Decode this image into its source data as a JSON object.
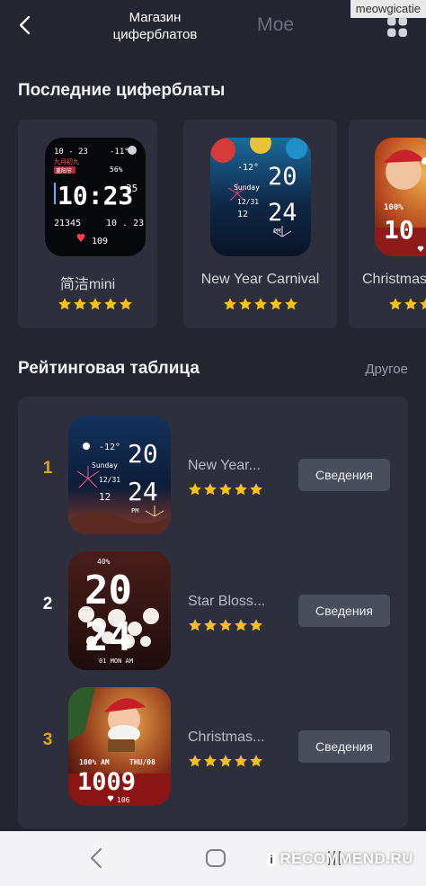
{
  "watermark_top": "meowgicatie",
  "header": {
    "tab_store": "Магазин циферблатов",
    "tab_mine": "Мое"
  },
  "recent": {
    "title": "Последние циферблаты",
    "items": [
      {
        "name": "简洁mini",
        "face": {
          "date": "10 - 23",
          "temp": "-11°",
          "subtitle": "九月初九",
          "tag": "重阳节",
          "battery": "56%",
          "time": "10:23",
          "seconds": "35",
          "steps": "21345",
          "date2": "10 . 23",
          "heart": "109"
        }
      },
      {
        "name": "New Year Carnival",
        "face": {
          "temp": "-12°",
          "day": "Sunday",
          "date": "12/31",
          "date2": "12",
          "hours": "20",
          "minutes": "24",
          "ampm": "PM"
        }
      },
      {
        "name": "Christmas",
        "face": {
          "battery": "100%",
          "time": "10"
        }
      }
    ]
  },
  "leaderboard": {
    "title": "Рейтинговая таблица",
    "other": "Другое",
    "button_label": "Сведения",
    "rows": [
      {
        "rank": "1",
        "rank_color": "#e2a317",
        "name": "New Year...",
        "face": {
          "temp": "-12°",
          "day": "Sunday",
          "date": "12/31",
          "date2": "12",
          "hours": "20",
          "minutes": "24",
          "ampm": "PM"
        }
      },
      {
        "rank": "2",
        "rank_color": "#ffffff",
        "name": "Star Bloss...",
        "face": {
          "battery": "40%",
          "hours": "20",
          "minutes": "24",
          "weekday": "01 MON AM"
        }
      },
      {
        "rank": "3",
        "rank_color": "#e2a317",
        "name": "Christmas...",
        "face": {
          "battery": "100% AM",
          "date": "THU/08",
          "time": "1009",
          "heart": "106"
        }
      }
    ]
  },
  "watermark_bottom": {
    "badge": "i",
    "text": "RECOMMEND.RU"
  },
  "colors": {
    "background": "#232631",
    "card": "#2d303c",
    "star": "#f6c21a",
    "button": "#4a4e5c",
    "gold_rank": "#e2a317"
  }
}
